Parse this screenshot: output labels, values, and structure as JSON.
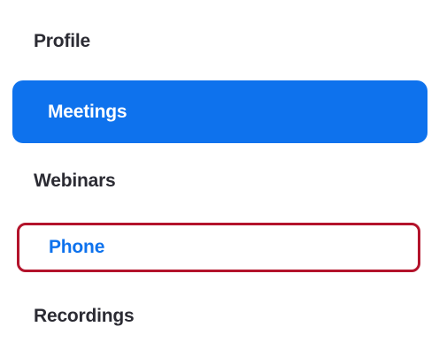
{
  "sidebar": {
    "items": [
      {
        "label": "Profile",
        "state": "default"
      },
      {
        "label": "Meetings",
        "state": "selected"
      },
      {
        "label": "Webinars",
        "state": "default"
      },
      {
        "label": "Phone",
        "state": "highlighted"
      },
      {
        "label": "Recordings",
        "state": "default"
      }
    ]
  },
  "colors": {
    "accent_blue": "#0e72ed",
    "highlight_border": "#b3132b",
    "text_default": "#2b2b33",
    "background": "#ffffff"
  }
}
